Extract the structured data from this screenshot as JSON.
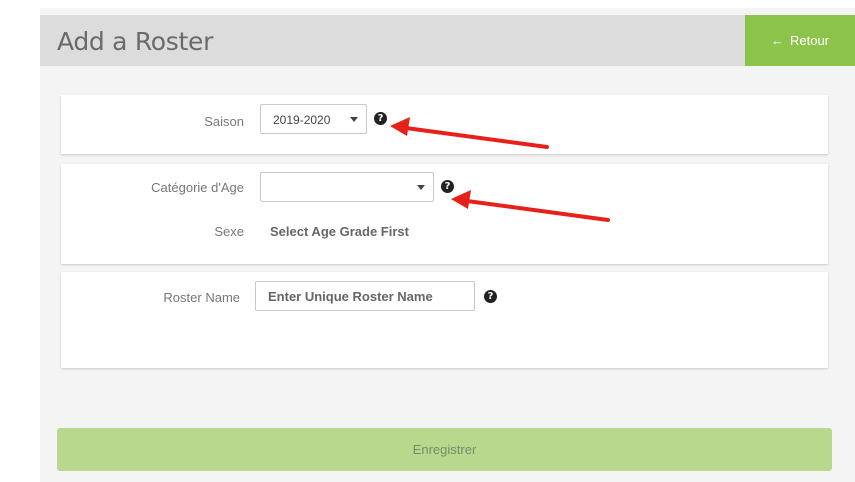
{
  "header": {
    "title": "Add a Roster",
    "back_label": "Retour",
    "back_icon": "arrow-left-icon",
    "accent_color": "#8cc34b"
  },
  "form": {
    "season": {
      "label": "Saison",
      "value": "2019-2020"
    },
    "age_category": {
      "label": "Catégorie d'Age",
      "value": ""
    },
    "gender": {
      "label": "Sexe",
      "value": "Select Age Grade First"
    },
    "roster_name": {
      "label": "Roster Name",
      "placeholder": "Enter Unique Roster Name"
    }
  },
  "help_icon_glyph": "?",
  "save_label": "Enregistrer",
  "annotation_color": "#e8201a"
}
